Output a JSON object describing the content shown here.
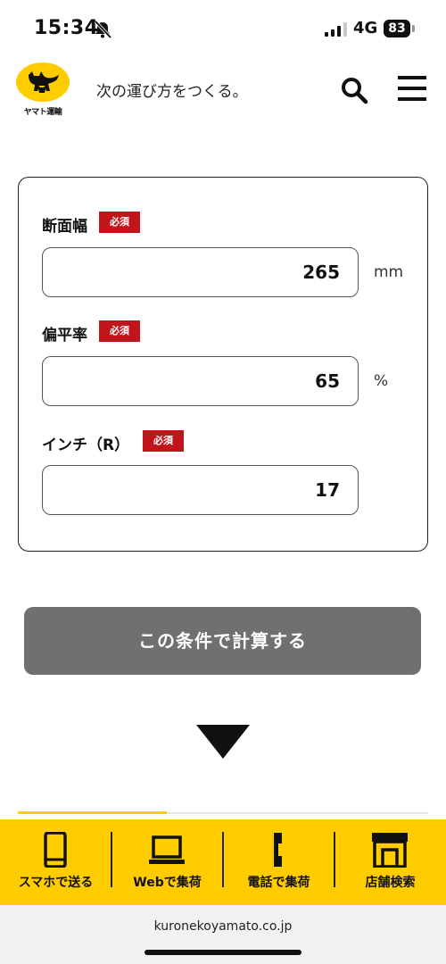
{
  "status": {
    "time": "15:34",
    "network": "4G",
    "battery": "83"
  },
  "header": {
    "logo_text": "ヤマト運輸",
    "tagline": "次の運び方をつくる。"
  },
  "form": {
    "fields": [
      {
        "label": "断面幅",
        "required": "必須",
        "value": "265",
        "unit": "mm"
      },
      {
        "label": "偏平率",
        "required": "必須",
        "value": "65",
        "unit": "%"
      },
      {
        "label": "インチ（R）",
        "required": "必須",
        "value": "17",
        "unit": ""
      }
    ]
  },
  "submit": {
    "label": "この条件で計算する"
  },
  "bottom_nav": {
    "items": [
      {
        "label": "スマホで送る",
        "icon": "smartphone-icon"
      },
      {
        "label": "Webで集荷",
        "icon": "laptop-icon"
      },
      {
        "label": "電話で集荷",
        "icon": "phone-icon"
      },
      {
        "label": "店舗検索",
        "icon": "store-icon"
      }
    ]
  },
  "browser": {
    "url": "kuronekoyamato.co.jp"
  },
  "colors": {
    "brand_yellow": "#ffcc00",
    "required_red": "#c0161b",
    "button_gray": "#707070"
  }
}
